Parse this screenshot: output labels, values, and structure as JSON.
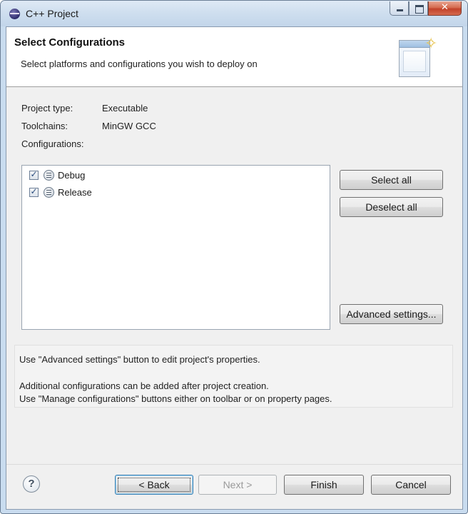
{
  "window": {
    "title": "C++ Project",
    "controls": {
      "minimize": "minimize",
      "maximize": "maximize",
      "close": "close"
    }
  },
  "banner": {
    "title": "Select Configurations",
    "description": "Select platforms and configurations you wish to deploy on"
  },
  "info": {
    "project_type_label": "Project type:",
    "project_type_value": "Executable",
    "toolchains_label": "Toolchains:",
    "toolchains_value": "MinGW GCC",
    "configurations_label": "Configurations:"
  },
  "configurations": [
    {
      "label": "Debug",
      "checked": true
    },
    {
      "label": "Release",
      "checked": true
    }
  ],
  "side_buttons": {
    "select_all": "Select all",
    "deselect_all": "Deselect all",
    "advanced_settings": "Advanced settings..."
  },
  "messages": {
    "line1": "Use \"Advanced settings\" button to edit project's properties.",
    "line2": "Additional configurations can be added after project creation.",
    "line3": "Use \"Manage configurations\" buttons either on toolbar or on property pages."
  },
  "footer": {
    "help": "?",
    "back": "< Back",
    "next": "Next >",
    "finish": "Finish",
    "cancel": "Cancel"
  }
}
